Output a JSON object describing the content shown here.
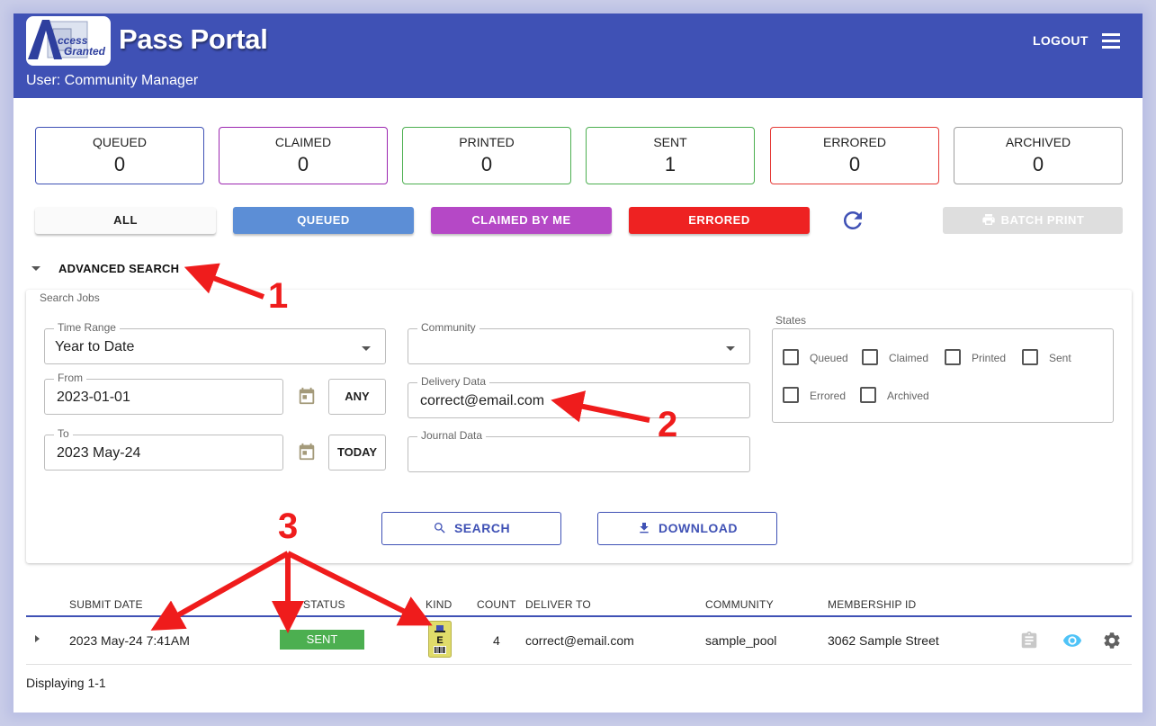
{
  "app": {
    "title": "Pass Portal",
    "logo_text": [
      "ccess",
      "Granted"
    ],
    "user": "User: Community Manager",
    "logout": "LOGOUT"
  },
  "counters": [
    {
      "label": "QUEUED",
      "value": "0",
      "color": "#3f51b5"
    },
    {
      "label": "CLAIMED",
      "value": "0",
      "color": "#9c27b0"
    },
    {
      "label": "PRINTED",
      "value": "0",
      "color": "#4caf50"
    },
    {
      "label": "SENT",
      "value": "1",
      "color": "#4caf50"
    },
    {
      "label": "ERRORED",
      "value": "0",
      "color": "#e53935"
    },
    {
      "label": "ARCHIVED",
      "value": "0",
      "color": "#9e9e9e"
    }
  ],
  "filters": [
    {
      "label": "ALL",
      "color": "#fafafa",
      "text_color": "#222222"
    },
    {
      "label": "QUEUED",
      "color": "#5c8ed6",
      "text_color": "#ffffff"
    },
    {
      "label": "CLAIMED BY ME",
      "color": "#b548c6",
      "text_color": "#ffffff"
    },
    {
      "label": "ERRORED",
      "color": "#ee2222",
      "text_color": "#ffffff"
    }
  ],
  "batch_print": "BATCH PRINT",
  "advanced_search": {
    "toggle_label": "ADVANCED SEARCH",
    "panel_title": "Search Jobs",
    "time_range": {
      "label": "Time Range",
      "value": "Year to Date"
    },
    "from": {
      "label": "From",
      "value": "2023-01-01",
      "button": "ANY"
    },
    "to": {
      "label": "To",
      "value": "2023 May-24",
      "button": "TODAY"
    },
    "community": {
      "label": "Community",
      "value": ""
    },
    "delivery_data": {
      "label": "Delivery Data",
      "value": "correct@email.com"
    },
    "journal_data": {
      "label": "Journal Data",
      "value": ""
    },
    "states": {
      "label": "States",
      "options": [
        "Queued",
        "Claimed",
        "Printed",
        "Sent",
        "Errored",
        "Archived"
      ]
    },
    "search_button": "SEARCH",
    "download_button": "DOWNLOAD"
  },
  "table": {
    "headers": [
      "SUBMIT DATE",
      "STATUS",
      "KIND",
      "COUNT",
      "DELIVER TO",
      "COMMUNITY",
      "MEMBERSHIP ID"
    ],
    "rows": [
      {
        "submit_date": "2023 May-24 7:41AM",
        "status": "SENT",
        "kind": "E",
        "count": "4",
        "deliver_to": "correct@email.com",
        "community": "sample_pool",
        "membership_id": "3062 Sample Street"
      }
    ],
    "footer": "Displaying 1-1"
  },
  "annotations": [
    "1",
    "2",
    "3"
  ],
  "colors": {
    "header_bg": "#3f51b5",
    "accent": "#3f51b5",
    "annotation_red": "#ef1c1c",
    "status_sent": "#4caf50",
    "view_icon": "#4fc3f7"
  }
}
